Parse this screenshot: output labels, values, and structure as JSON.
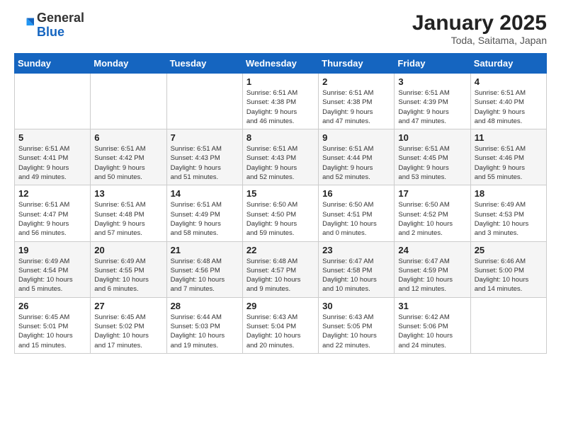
{
  "header": {
    "logo_general": "General",
    "logo_blue": "Blue",
    "title": "January 2025",
    "subtitle": "Toda, Saitama, Japan"
  },
  "weekdays": [
    "Sunday",
    "Monday",
    "Tuesday",
    "Wednesday",
    "Thursday",
    "Friday",
    "Saturday"
  ],
  "weeks": [
    [
      {
        "day": "",
        "info": ""
      },
      {
        "day": "",
        "info": ""
      },
      {
        "day": "",
        "info": ""
      },
      {
        "day": "1",
        "info": "Sunrise: 6:51 AM\nSunset: 4:38 PM\nDaylight: 9 hours\nand 46 minutes."
      },
      {
        "day": "2",
        "info": "Sunrise: 6:51 AM\nSunset: 4:38 PM\nDaylight: 9 hours\nand 47 minutes."
      },
      {
        "day": "3",
        "info": "Sunrise: 6:51 AM\nSunset: 4:39 PM\nDaylight: 9 hours\nand 47 minutes."
      },
      {
        "day": "4",
        "info": "Sunrise: 6:51 AM\nSunset: 4:40 PM\nDaylight: 9 hours\nand 48 minutes."
      }
    ],
    [
      {
        "day": "5",
        "info": "Sunrise: 6:51 AM\nSunset: 4:41 PM\nDaylight: 9 hours\nand 49 minutes."
      },
      {
        "day": "6",
        "info": "Sunrise: 6:51 AM\nSunset: 4:42 PM\nDaylight: 9 hours\nand 50 minutes."
      },
      {
        "day": "7",
        "info": "Sunrise: 6:51 AM\nSunset: 4:43 PM\nDaylight: 9 hours\nand 51 minutes."
      },
      {
        "day": "8",
        "info": "Sunrise: 6:51 AM\nSunset: 4:43 PM\nDaylight: 9 hours\nand 52 minutes."
      },
      {
        "day": "9",
        "info": "Sunrise: 6:51 AM\nSunset: 4:44 PM\nDaylight: 9 hours\nand 52 minutes."
      },
      {
        "day": "10",
        "info": "Sunrise: 6:51 AM\nSunset: 4:45 PM\nDaylight: 9 hours\nand 53 minutes."
      },
      {
        "day": "11",
        "info": "Sunrise: 6:51 AM\nSunset: 4:46 PM\nDaylight: 9 hours\nand 55 minutes."
      }
    ],
    [
      {
        "day": "12",
        "info": "Sunrise: 6:51 AM\nSunset: 4:47 PM\nDaylight: 9 hours\nand 56 minutes."
      },
      {
        "day": "13",
        "info": "Sunrise: 6:51 AM\nSunset: 4:48 PM\nDaylight: 9 hours\nand 57 minutes."
      },
      {
        "day": "14",
        "info": "Sunrise: 6:51 AM\nSunset: 4:49 PM\nDaylight: 9 hours\nand 58 minutes."
      },
      {
        "day": "15",
        "info": "Sunrise: 6:50 AM\nSunset: 4:50 PM\nDaylight: 9 hours\nand 59 minutes."
      },
      {
        "day": "16",
        "info": "Sunrise: 6:50 AM\nSunset: 4:51 PM\nDaylight: 10 hours\nand 0 minutes."
      },
      {
        "day": "17",
        "info": "Sunrise: 6:50 AM\nSunset: 4:52 PM\nDaylight: 10 hours\nand 2 minutes."
      },
      {
        "day": "18",
        "info": "Sunrise: 6:49 AM\nSunset: 4:53 PM\nDaylight: 10 hours\nand 3 minutes."
      }
    ],
    [
      {
        "day": "19",
        "info": "Sunrise: 6:49 AM\nSunset: 4:54 PM\nDaylight: 10 hours\nand 5 minutes."
      },
      {
        "day": "20",
        "info": "Sunrise: 6:49 AM\nSunset: 4:55 PM\nDaylight: 10 hours\nand 6 minutes."
      },
      {
        "day": "21",
        "info": "Sunrise: 6:48 AM\nSunset: 4:56 PM\nDaylight: 10 hours\nand 7 minutes."
      },
      {
        "day": "22",
        "info": "Sunrise: 6:48 AM\nSunset: 4:57 PM\nDaylight: 10 hours\nand 9 minutes."
      },
      {
        "day": "23",
        "info": "Sunrise: 6:47 AM\nSunset: 4:58 PM\nDaylight: 10 hours\nand 10 minutes."
      },
      {
        "day": "24",
        "info": "Sunrise: 6:47 AM\nSunset: 4:59 PM\nDaylight: 10 hours\nand 12 minutes."
      },
      {
        "day": "25",
        "info": "Sunrise: 6:46 AM\nSunset: 5:00 PM\nDaylight: 10 hours\nand 14 minutes."
      }
    ],
    [
      {
        "day": "26",
        "info": "Sunrise: 6:45 AM\nSunset: 5:01 PM\nDaylight: 10 hours\nand 15 minutes."
      },
      {
        "day": "27",
        "info": "Sunrise: 6:45 AM\nSunset: 5:02 PM\nDaylight: 10 hours\nand 17 minutes."
      },
      {
        "day": "28",
        "info": "Sunrise: 6:44 AM\nSunset: 5:03 PM\nDaylight: 10 hours\nand 19 minutes."
      },
      {
        "day": "29",
        "info": "Sunrise: 6:43 AM\nSunset: 5:04 PM\nDaylight: 10 hours\nand 20 minutes."
      },
      {
        "day": "30",
        "info": "Sunrise: 6:43 AM\nSunset: 5:05 PM\nDaylight: 10 hours\nand 22 minutes."
      },
      {
        "day": "31",
        "info": "Sunrise: 6:42 AM\nSunset: 5:06 PM\nDaylight: 10 hours\nand 24 minutes."
      },
      {
        "day": "",
        "info": ""
      }
    ]
  ]
}
